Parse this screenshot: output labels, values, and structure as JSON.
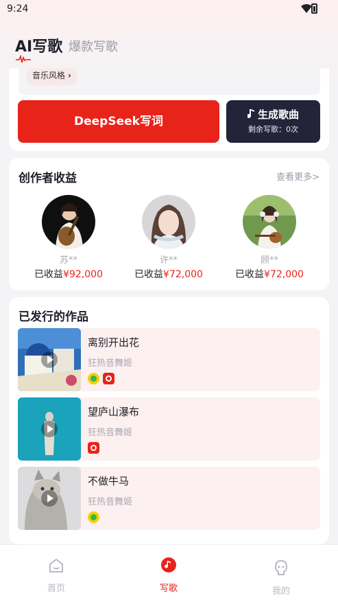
{
  "status_bar": {
    "time": "9:24"
  },
  "header": {
    "active_tab": "AI写歌",
    "inactive_tab": "爆款写歌"
  },
  "compose": {
    "style_label": "音乐风格",
    "deepseek_button": "DeepSeek写词",
    "generate_button": "生成歌曲",
    "remaining_text": "剩余写歌：0次"
  },
  "creators": {
    "title": "创作者收益",
    "more": "查看更多>",
    "earn_prefix": "已收益",
    "items": [
      {
        "name": "苏**",
        "amount": "¥92,000"
      },
      {
        "name": "许**",
        "amount": "¥72,000"
      },
      {
        "name": "顾**",
        "amount": "¥72,000"
      }
    ]
  },
  "works": {
    "title": "已发行的作品",
    "items": [
      {
        "title": "离别开出花",
        "artist": "狂热音舞姬",
        "platforms": [
          "qq-music-icon",
          "netease-music-icon"
        ]
      },
      {
        "title": "望庐山瀑布",
        "artist": "狂热音舞姬",
        "platforms": [
          "netease-music-icon"
        ]
      },
      {
        "title": "不做牛马",
        "artist": "狂热音舞姬",
        "platforms": [
          "qq-music-icon"
        ]
      }
    ]
  },
  "bottom_nav": {
    "items": [
      {
        "label": "首页",
        "icon": "home-icon"
      },
      {
        "label": "写歌",
        "icon": "music-note-icon",
        "active": true
      },
      {
        "label": "我的",
        "icon": "profile-icon"
      }
    ]
  },
  "colors": {
    "accent": "#e8231a",
    "dark_button": "#23233a",
    "muted": "#9a9aa8"
  }
}
